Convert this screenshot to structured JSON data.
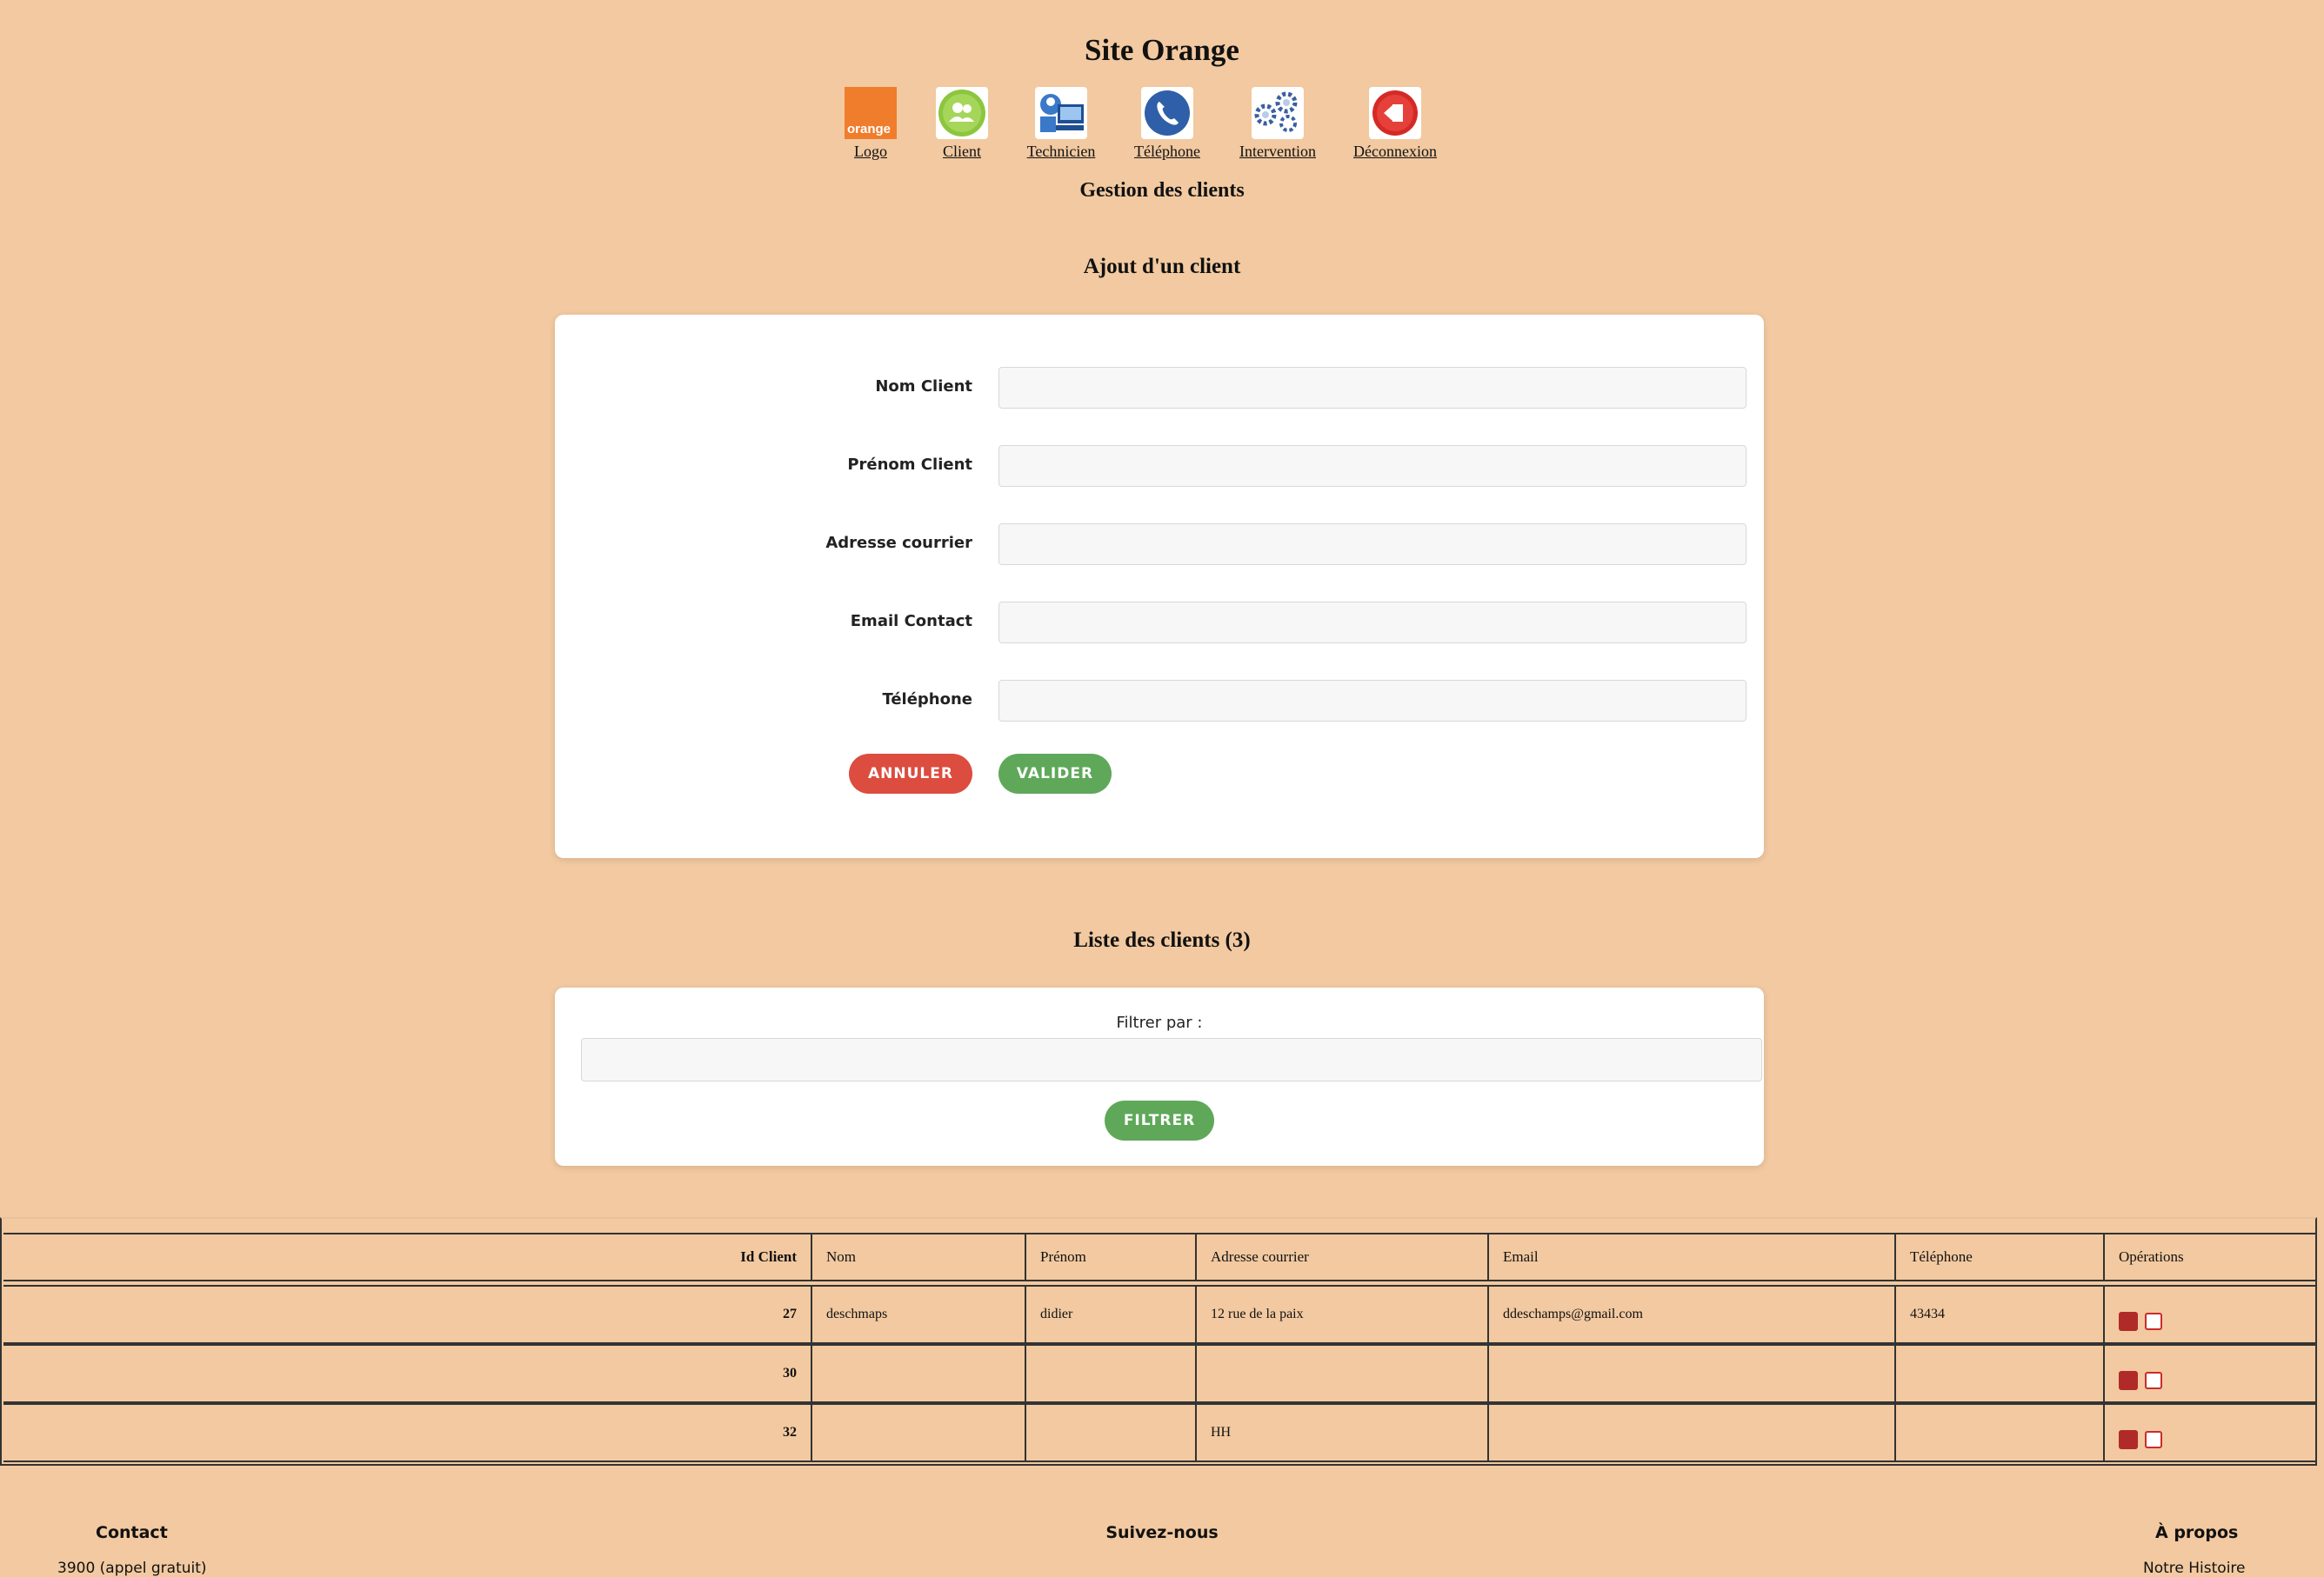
{
  "site": {
    "title": "Site Orange"
  },
  "nav": {
    "items": [
      {
        "label": "Logo",
        "icon": "orange-logo-icon"
      },
      {
        "label": "Client",
        "icon": "client-icon"
      },
      {
        "label": "Technicien",
        "icon": "technician-icon"
      },
      {
        "label": "Téléphone",
        "icon": "phone-icon"
      },
      {
        "label": "Intervention",
        "icon": "gears-icon"
      },
      {
        "label": "Déconnexion",
        "icon": "logout-icon"
      }
    ],
    "logo_text": "orange"
  },
  "section": {
    "title": "Gestion des clients"
  },
  "form": {
    "title": "Ajout d'un client",
    "fields": [
      {
        "label": "Nom Client",
        "value": ""
      },
      {
        "label": "Prénom Client",
        "value": ""
      },
      {
        "label": "Adresse courrier",
        "value": ""
      },
      {
        "label": "Email Contact",
        "value": ""
      },
      {
        "label": "Téléphone",
        "value": ""
      }
    ],
    "cancel_label": "ANNULER",
    "submit_label": "VALIDER"
  },
  "list": {
    "title": "Liste des clients (3)",
    "filter_label": "Filtrer par :",
    "filter_value": "",
    "filter_button": "FILTRER",
    "columns": [
      "Id Client",
      "Nom",
      "Prénom",
      "Adresse courrier",
      "Email",
      "Téléphone",
      "Opérations"
    ],
    "rows": [
      {
        "id": "27",
        "nom": "deschmaps",
        "prenom": "didier",
        "adresse": "12 rue de la paix",
        "email": "ddeschamps@gmail.com",
        "telephone": "43434"
      },
      {
        "id": "30",
        "nom": "",
        "prenom": "",
        "adresse": "",
        "email": "",
        "telephone": ""
      },
      {
        "id": "32",
        "nom": "",
        "prenom": "",
        "adresse": "HH",
        "email": "",
        "telephone": ""
      }
    ]
  },
  "footer": {
    "contact_title": "Contact",
    "contact_line": "3900 (appel gratuit)",
    "follow_title": "Suivez-nous",
    "about_title": "À propos",
    "about_line": "Notre Histoire"
  },
  "colors": {
    "background": "#f2c9a0",
    "cancel": "#dc4c3f",
    "submit": "#5fa85a"
  }
}
